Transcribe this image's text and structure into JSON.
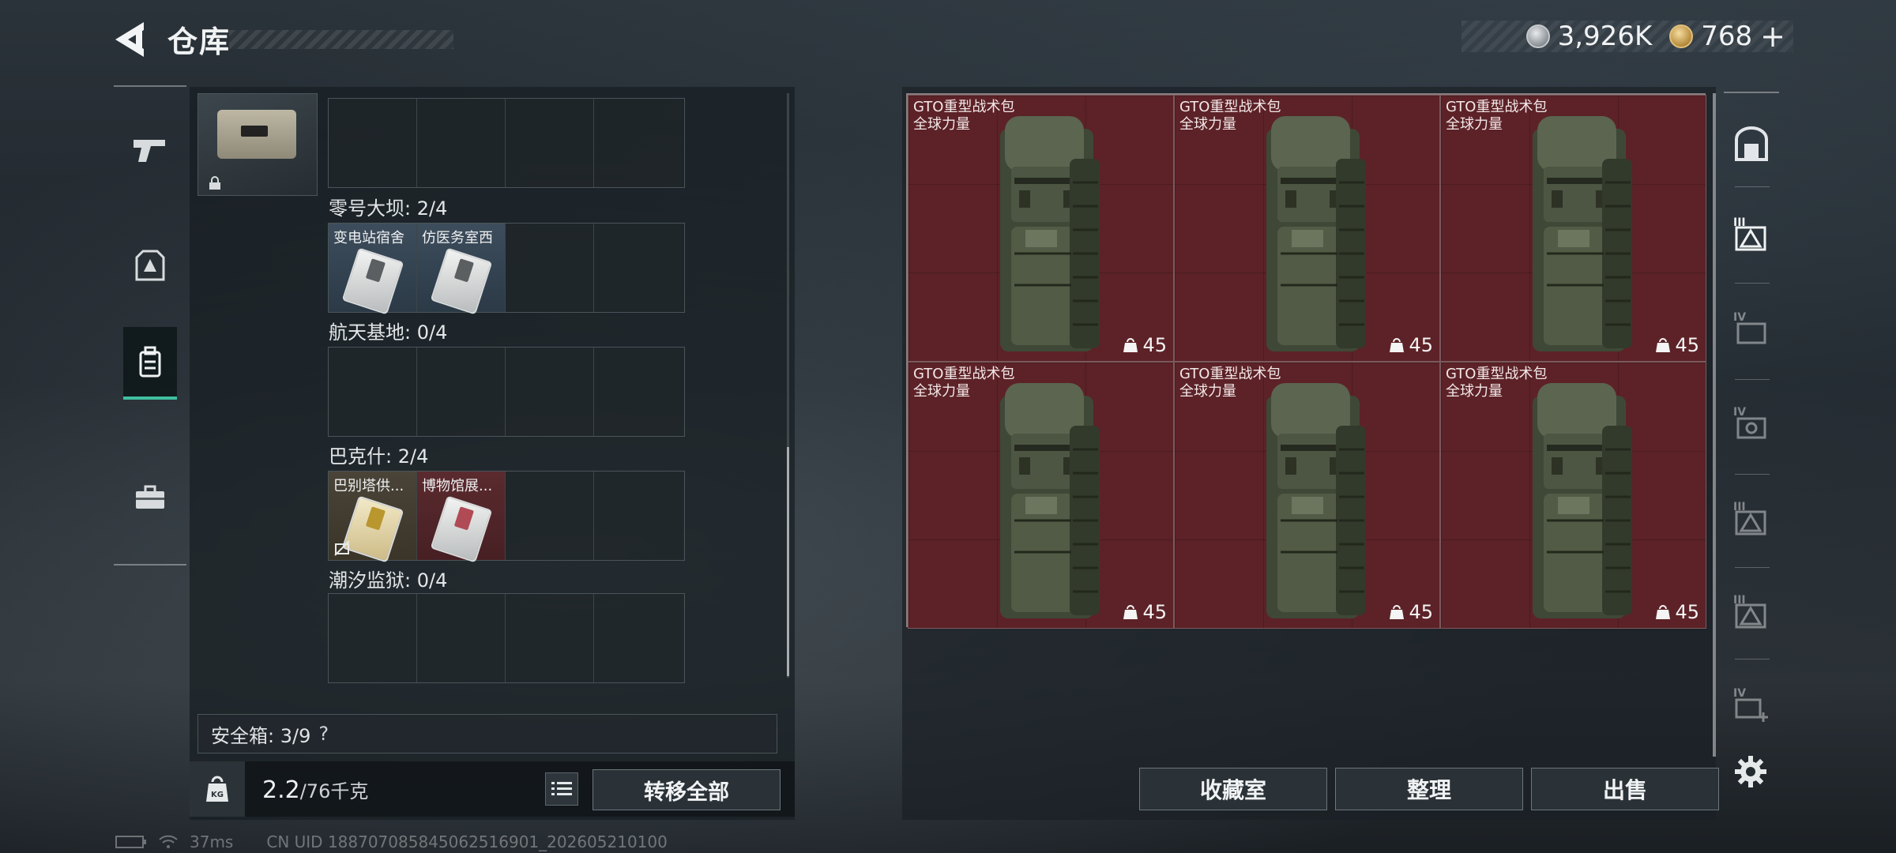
{
  "header": {
    "title": "仓库"
  },
  "currency": {
    "silver": "3,926K",
    "gold": "768",
    "gold_add": "+"
  },
  "safe_container": {
    "items": [
      {
        "region": "零号大坝: 2/4",
        "cards": [
          "变电站宿舍",
          "仿医务室西"
        ]
      },
      {
        "region": "航天基地: 0/4",
        "cards": []
      },
      {
        "region": "巴克什: 2/4",
        "cards": [
          "巴别塔供...",
          "博物馆展..."
        ]
      },
      {
        "region": "潮汐监狱: 0/4",
        "cards": []
      }
    ]
  },
  "safebox": {
    "label": "安全箱: 3/9",
    "help": "?"
  },
  "weight": {
    "current": "2.2",
    "max": "/76千克",
    "kg_badge": "KG"
  },
  "buttons": {
    "transfer_all": "转移全部",
    "collection": "收藏室",
    "organize": "整理",
    "sell": "出售"
  },
  "bags": [
    {
      "name": "GTO重型战术包",
      "tag": "全球力量",
      "weight": "45"
    },
    {
      "name": "GTO重型战术包",
      "tag": "全球力量",
      "weight": "45"
    },
    {
      "name": "GTO重型战术包",
      "tag": "全球力量",
      "weight": "45"
    },
    {
      "name": "GTO重型战术包",
      "tag": "全球力量",
      "weight": "45"
    },
    {
      "name": "GTO重型战术包",
      "tag": "全球力量",
      "weight": "45"
    },
    {
      "name": "GTO重型战术包",
      "tag": "全球力量",
      "weight": "45"
    }
  ],
  "right_nav": [
    "III",
    "IV",
    "IV",
    "III",
    "III",
    "IV"
  ],
  "status": {
    "ping": "37ms",
    "uid": "CN UID 18870708584506251​6901_202605210100"
  },
  "colors": {
    "accent": "#3fc0a0",
    "item_red": "#5c2227"
  }
}
